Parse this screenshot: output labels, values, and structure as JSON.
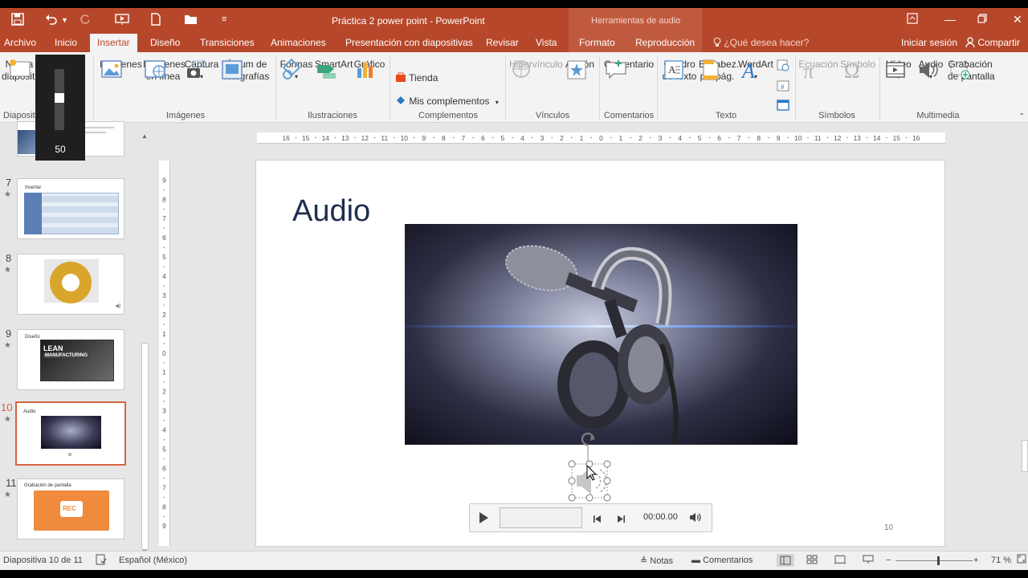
{
  "titlebar": {
    "document_title": "Práctica 2  power point - PowerPoint",
    "contextual_title": "Herramientas de audio"
  },
  "tabs": [
    {
      "label": "Archivo"
    },
    {
      "label": "Inicio"
    },
    {
      "label": "Insertar",
      "active": true
    },
    {
      "label": "Diseño"
    },
    {
      "label": "Transiciones"
    },
    {
      "label": "Animaciones"
    },
    {
      "label": "Presentación con diapositivas"
    },
    {
      "label": "Revisar"
    },
    {
      "label": "Vista"
    },
    {
      "label": "Formato"
    },
    {
      "label": "Reproducción"
    }
  ],
  "tell_me": "¿Qué desea hacer?",
  "account": {
    "signin": "Iniciar sesión",
    "share": "Compartir"
  },
  "ribbon": {
    "new_slide": [
      "Nueva",
      "diapositiva"
    ],
    "group_diapositivas": "Diapositivas",
    "images": {
      "imagenes": "Imágenes",
      "en_linea": [
        "Imágenes",
        "en línea"
      ],
      "captura": "Captura",
      "album": [
        "Álbum de",
        "fotografías"
      ],
      "group": "Imágenes"
    },
    "illustrations": {
      "formas": "Formas",
      "smartart": "SmartArt",
      "grafico": "Gráfico",
      "group": "Ilustraciones"
    },
    "addins": {
      "tienda": "Tienda",
      "mis": "Mis complementos",
      "group": "Complementos"
    },
    "links": {
      "hipervinculo": "Hipervínculo",
      "accion": "Acción",
      "group": "Vínculos"
    },
    "comments": {
      "comentario": "Comentario",
      "group": "Comentarios"
    },
    "text": {
      "cuadro": [
        "Cuadro",
        "de texto"
      ],
      "encabez": [
        "Encabez.",
        "pie pág."
      ],
      "wordart": "WordArt",
      "group": "Texto"
    },
    "symbols": {
      "ecuacion": "Ecuación",
      "simbolo": "Símbolo",
      "group": "Símbolos"
    },
    "media": {
      "video": "Vídeo",
      "audio": "Audio",
      "grabacion": [
        "Grabación",
        "de pantalla"
      ],
      "group": "Multimedia"
    }
  },
  "zoom_popup": {
    "value": "50",
    "level_fraction": 0.5
  },
  "thumbnails": [
    {
      "num": "7",
      "caption": "Insertar"
    },
    {
      "num": "8",
      "caption": ""
    },
    {
      "num": "9",
      "caption": "Diseño",
      "text": [
        "LEAN",
        "MANUFACTURING"
      ]
    },
    {
      "num": "10",
      "caption": "Audio",
      "selected": true
    },
    {
      "num": "11",
      "caption": "Grabación de pantalla",
      "text": [
        "REC"
      ]
    }
  ],
  "slide": {
    "title": "Audio",
    "number": "10",
    "player_time": "00:00.00"
  },
  "ruler": {
    "horizontal": [
      "16",
      "15",
      "14",
      "13",
      "12",
      "11",
      "10",
      "9",
      "8",
      "7",
      "6",
      "5",
      "4",
      "3",
      "2",
      "1",
      "0",
      "1",
      "2",
      "3",
      "4",
      "5",
      "6",
      "7",
      "8",
      "9",
      "10",
      "11",
      "12",
      "13",
      "14",
      "15",
      "16"
    ],
    "vertical": [
      "9",
      "8",
      "7",
      "6",
      "5",
      "4",
      "3",
      "2",
      "1",
      "0",
      "1",
      "2",
      "3",
      "4",
      "5",
      "6",
      "7",
      "8",
      "9"
    ]
  },
  "status": {
    "slide_of": "Diapositiva 10 de 11",
    "language": "Español (México)",
    "notes": "Notas",
    "comments": "Comentarios",
    "zoom": "71 %",
    "zoom_fraction": 0.55
  },
  "colors": {
    "accent": "#b7472a",
    "contextual": "#c05a3e",
    "selection": "#d5633f"
  }
}
